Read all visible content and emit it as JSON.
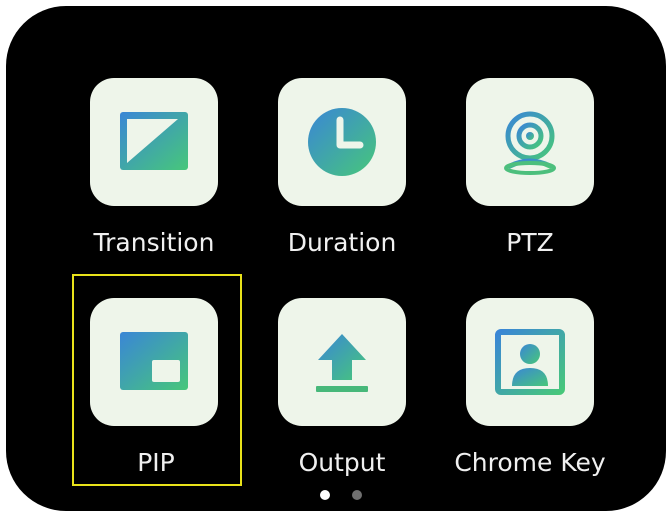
{
  "menu": {
    "items": [
      {
        "label": "Transition",
        "icon": "transition-icon"
      },
      {
        "label": "Duration",
        "icon": "clock-icon"
      },
      {
        "label": "PTZ",
        "icon": "webcam-icon"
      },
      {
        "label": "PIP",
        "icon": "picture-in-picture-icon"
      },
      {
        "label": "Output",
        "icon": "upload-icon"
      },
      {
        "label": "Chrome Key",
        "icon": "chroma-key-person-icon"
      }
    ],
    "selected_index": 3
  },
  "pagination": {
    "total_pages": 2,
    "current_page": 1
  },
  "colors": {
    "screen_background": "#000000",
    "tile_background": "#eef5ea",
    "icon_gradient_start": "#3a86d6",
    "icon_gradient_end": "#47c77a",
    "selection_outline": "#e8e21a",
    "dot_active": "#ffffff",
    "dot_inactive": "#6f6f6f"
  }
}
